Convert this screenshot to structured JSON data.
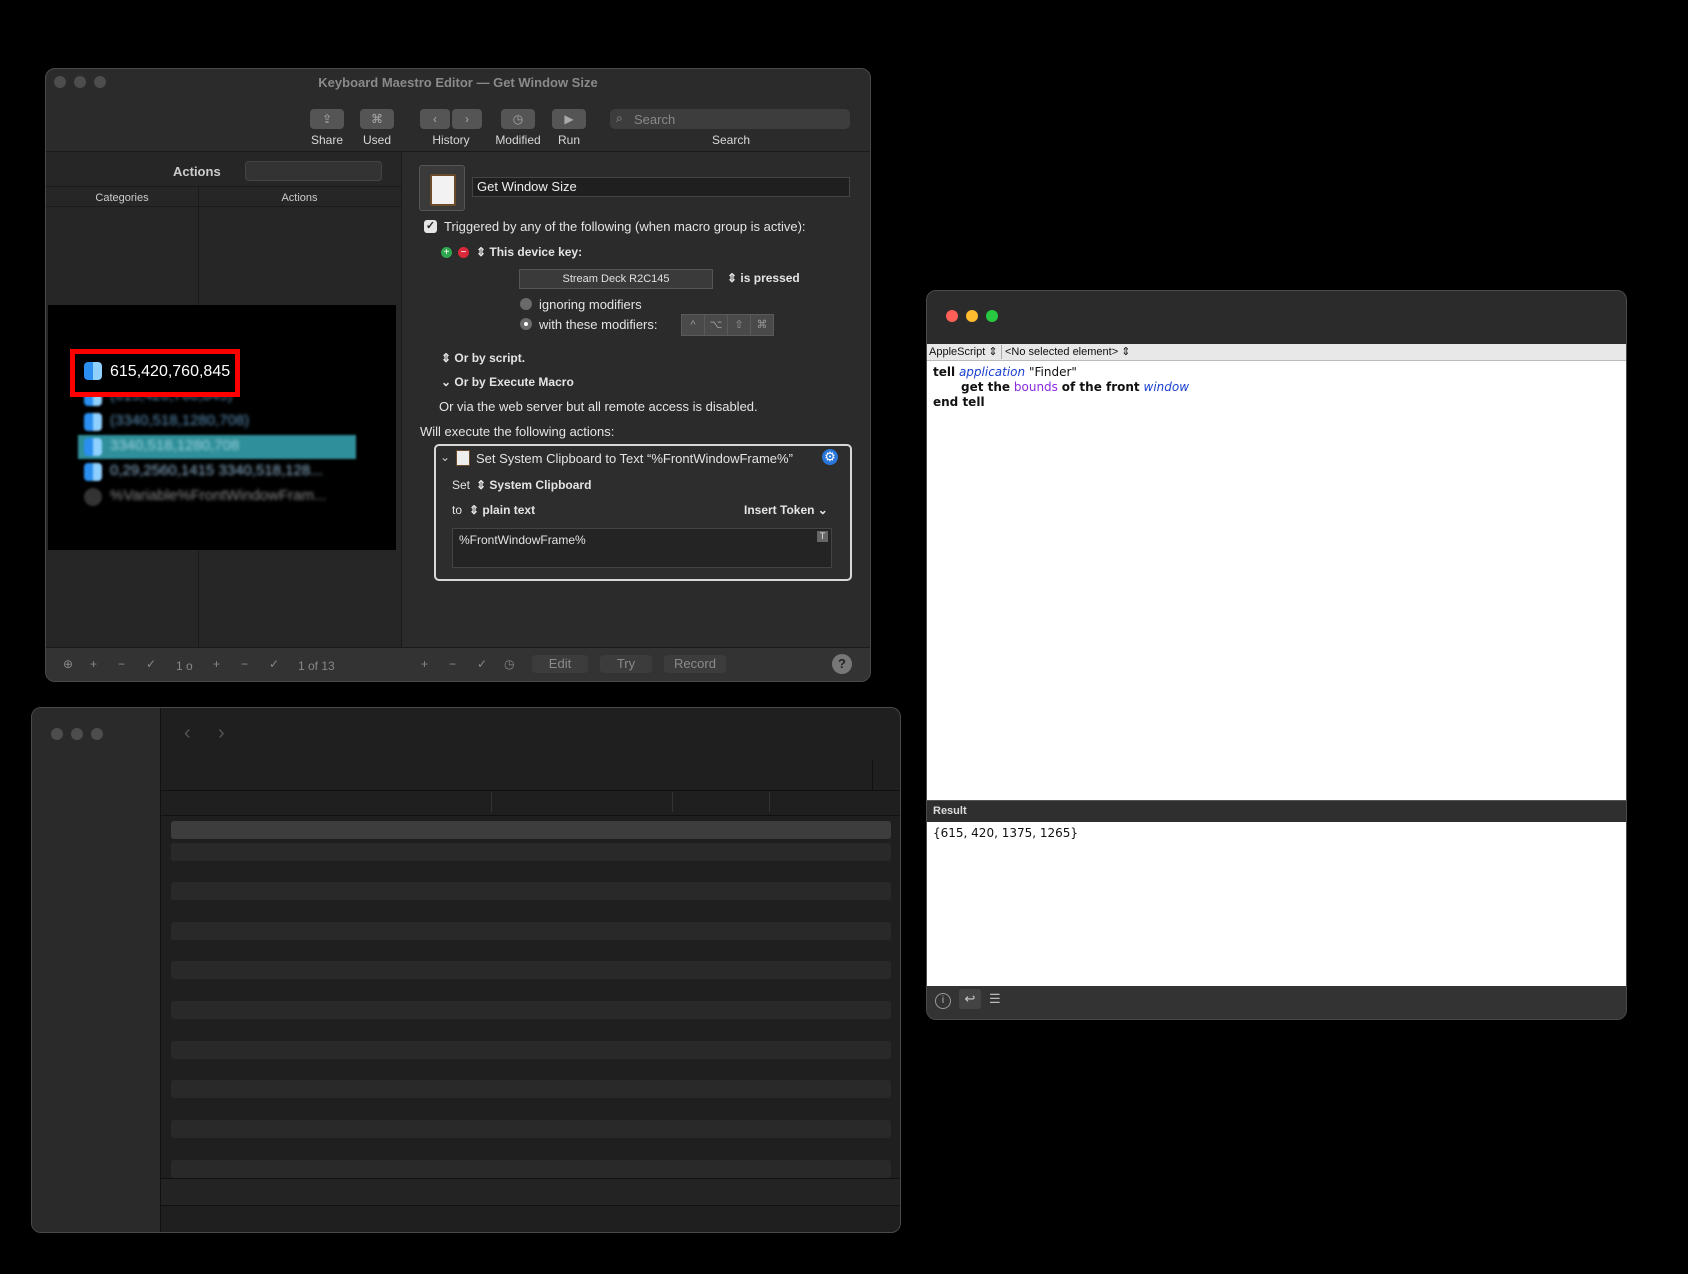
{
  "km": {
    "title": "Keyboard Maestro Editor — Get Window Size",
    "toolbar": {
      "share": "Share",
      "used": "Used",
      "history": "History",
      "modified": "Modified",
      "run": "Run",
      "search_placeholder": "Search",
      "search_label": "Search"
    },
    "left": {
      "header": "Actions",
      "col_categories": "Categories",
      "col_actions": "Actions"
    },
    "macro_name": "Get Window Size",
    "trigger_header": "Triggered by any of the following (when macro group is active):",
    "device_key_label": "This device key:",
    "device_key_value": "Stream Deck R2C145",
    "is_pressed": "is pressed",
    "ignoring_modifiers": "ignoring modifiers",
    "with_modifiers": "with these modifiers:",
    "modifier_keys": [
      "^",
      "⌥",
      "⇧",
      "⌘"
    ],
    "or_by_script": "Or by script.",
    "or_by_execute": "Or by Execute Macro",
    "web_server": "Or via the web server but all remote access is disabled.",
    "will_execute": "Will execute the following actions:",
    "action_title": "Set System Clipboard to Text “%FrontWindowFrame%”",
    "set_label": "Set",
    "clipboard": "System Clipboard",
    "to_label": "to",
    "plain_text": "plain text",
    "insert_token": "Insert Token",
    "token_text": "%FrontWindowFrame%",
    "bottom": {
      "count_a": "1 o",
      "count_b": "1 of 13",
      "edit": "Edit",
      "try": "Try",
      "record": "Record",
      "help": "?"
    }
  },
  "clipboard_popup": {
    "highlight": "615,420,760,845",
    "rows": [
      "(615,420,760,845)",
      "(3340,518,1280,708)",
      "3340,518,1280,708",
      "0,29,2560,1415 3340,518,128...",
      "%Variable%FrontWindowFram..."
    ]
  },
  "script_editor": {
    "language": "AppleScript",
    "element": "<No selected element>",
    "code": {
      "l1_kw": "tell",
      "l1_app": "application",
      "l1_str": "\"Finder\"",
      "l2_a": "get the",
      "l2_prop": "bounds",
      "l2_b": "of the front",
      "l2_cls": "window",
      "l3": "end tell"
    },
    "result_label": "Result",
    "result": "{615, 420, 1375, 1265}"
  },
  "colors": {
    "highlight_red": "#ff0000",
    "selection_teal": "#2f8f9a",
    "applescript_blue": "#1a3fd0",
    "applescript_purple": "#8a2be2"
  }
}
